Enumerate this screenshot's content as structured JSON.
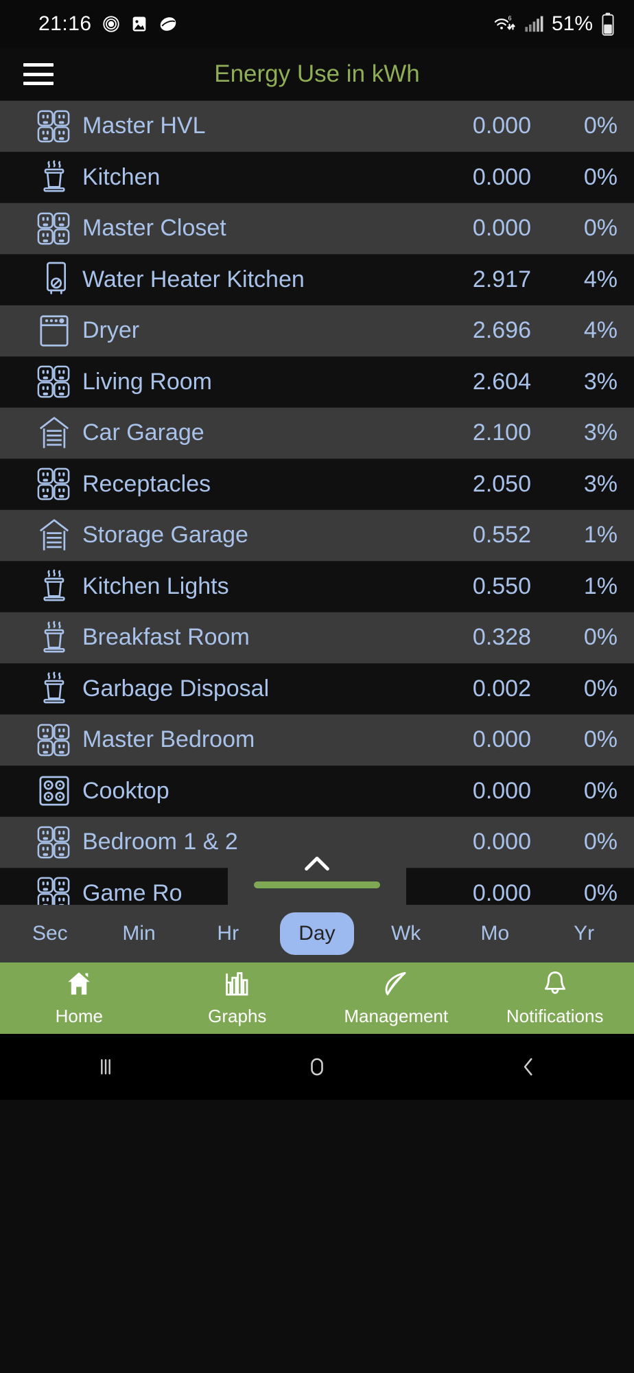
{
  "statusbar": {
    "time": "21:16",
    "battery_text": "51%",
    "icons": [
      "fingerprint-icon",
      "photo-icon",
      "app-blob-icon"
    ],
    "right_icons": [
      "wifi-icon",
      "cellular-signal-icon",
      "battery-icon"
    ]
  },
  "header": {
    "menu_icon": "hamburger-menu-icon",
    "title": "Energy Use in kWh",
    "title_color": "#8fae55"
  },
  "list": {
    "rows": [
      {
        "icon": "quad-outlet-icon",
        "label": "Master HVL",
        "value": "0.000",
        "percent": "0%"
      },
      {
        "icon": "steam-pot-icon",
        "label": "Kitchen",
        "value": "0.000",
        "percent": "0%"
      },
      {
        "icon": "quad-outlet-icon",
        "label": "Master Closet",
        "value": "0.000",
        "percent": "0%"
      },
      {
        "icon": "water-heater-icon",
        "label": "Water Heater Kitchen",
        "value": "2.917",
        "percent": "4%"
      },
      {
        "icon": "dryer-icon",
        "label": "Dryer",
        "value": "2.696",
        "percent": "4%"
      },
      {
        "icon": "quad-outlet-icon",
        "label": "Living Room",
        "value": "2.604",
        "percent": "3%"
      },
      {
        "icon": "garage-icon",
        "label": "Car Garage",
        "value": "2.100",
        "percent": "3%"
      },
      {
        "icon": "quad-outlet-icon",
        "label": "Receptacles",
        "value": "2.050",
        "percent": "3%"
      },
      {
        "icon": "garage-icon",
        "label": "Storage Garage",
        "value": "0.552",
        "percent": "1%"
      },
      {
        "icon": "steam-pot-icon",
        "label": "Kitchen Lights",
        "value": "0.550",
        "percent": "1%"
      },
      {
        "icon": "steam-pot-icon",
        "label": "Breakfast Room",
        "value": "0.328",
        "percent": "0%"
      },
      {
        "icon": "steam-pot-icon",
        "label": "Garbage Disposal",
        "value": "0.002",
        "percent": "0%"
      },
      {
        "icon": "quad-outlet-icon",
        "label": "Master Bedroom",
        "value": "0.000",
        "percent": "0%"
      },
      {
        "icon": "cooktop-icon",
        "label": "Cooktop",
        "value": "0.000",
        "percent": "0%"
      },
      {
        "icon": "quad-outlet-icon",
        "label": "Bedroom 1 & 2",
        "value": "0.000",
        "percent": "0%"
      },
      {
        "icon": "quad-outlet-icon",
        "label": "Game Ro",
        "value": "0.000",
        "percent": "0%"
      }
    ]
  },
  "drag_handle": {
    "chevron_icon": "chevron-up-icon",
    "bar_color": "#7fa855"
  },
  "period_selector": {
    "selected": "Day",
    "accent": "#9dbaf0",
    "options": [
      {
        "label": "Sec"
      },
      {
        "label": "Min"
      },
      {
        "label": "Hr"
      },
      {
        "label": "Day"
      },
      {
        "label": "Wk"
      },
      {
        "label": "Mo"
      },
      {
        "label": "Yr"
      }
    ]
  },
  "bottom_nav": {
    "background": "#7fa855",
    "items": [
      {
        "icon": "home-icon",
        "label": "Home"
      },
      {
        "icon": "bar-chart-icon",
        "label": "Graphs"
      },
      {
        "icon": "leaf-icon",
        "label": "Management"
      },
      {
        "icon": "bell-icon",
        "label": "Notifications"
      }
    ]
  },
  "android_nav": {
    "items": [
      {
        "icon": "recents-icon"
      },
      {
        "icon": "home-circle-icon"
      },
      {
        "icon": "back-icon"
      }
    ]
  }
}
